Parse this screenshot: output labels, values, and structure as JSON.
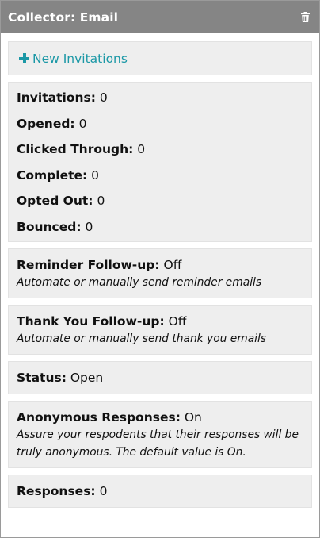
{
  "header": {
    "title": "Collector: Email",
    "delete_icon": "trash-icon"
  },
  "actions": {
    "new_invitations_label": "New Invitations",
    "new_icon": "plus-icon"
  },
  "stats": [
    {
      "label": "Invitations:",
      "value": "0"
    },
    {
      "label": "Opened:",
      "value": "0"
    },
    {
      "label": "Clicked Through:",
      "value": "0"
    },
    {
      "label": "Complete:",
      "value": "0"
    },
    {
      "label": "Opted Out:",
      "value": "0"
    },
    {
      "label": "Bounced:",
      "value": "0"
    }
  ],
  "reminder": {
    "label": "Reminder Follow-up:",
    "value": "Off",
    "description": "Automate or manually send reminder emails"
  },
  "thank_you": {
    "label": "Thank You Follow-up:",
    "value": "Off",
    "description": "Automate or manually send thank you emails"
  },
  "status": {
    "label": "Status:",
    "value": "Open"
  },
  "anonymous": {
    "label": "Anonymous Responses:",
    "value": "On",
    "description": "Assure your respodents that their responses will be truly anonymous. The default value is On."
  },
  "responses": {
    "label": "Responses:",
    "value": "0"
  },
  "colors": {
    "header_bg": "#858585",
    "card_bg": "#eeeeee",
    "accent": "#1b98a6"
  }
}
